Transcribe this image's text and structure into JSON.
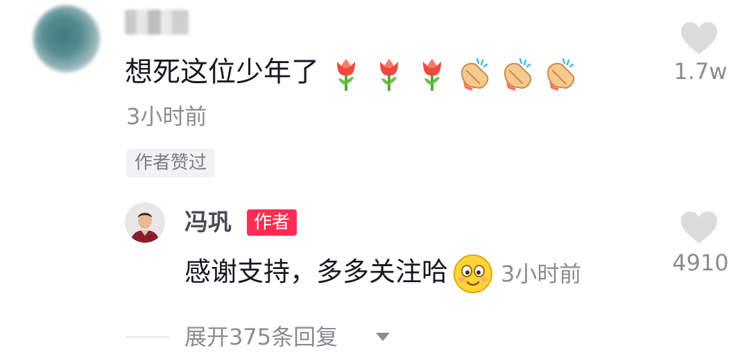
{
  "comment": {
    "text": "想死这位少年了",
    "emojis": [
      "tulip-icon",
      "tulip-icon",
      "tulip-icon",
      "clapping-hands-icon",
      "clapping-hands-icon",
      "clapping-hands-icon"
    ],
    "time": "3小时前",
    "badge": "作者赞过",
    "like_count": "1.7w"
  },
  "reply": {
    "username": "冯巩",
    "author_tag": "作者",
    "text": "感谢支持，多多关注哈",
    "emoji": "smiling-face-icon",
    "time": "3小时前",
    "like_count": "4910"
  },
  "expand": {
    "label": "展开375条回复"
  },
  "colors": {
    "accent": "#fe2c55",
    "secondary_text": "#8a8b91",
    "like_icon": "#dcdcdc"
  }
}
